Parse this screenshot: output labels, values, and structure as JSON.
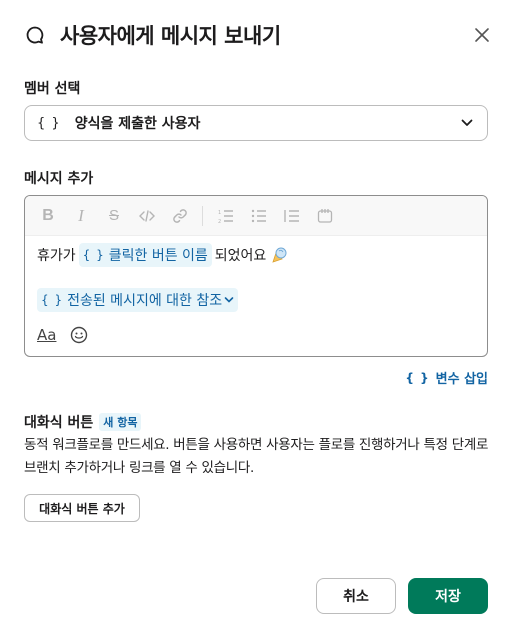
{
  "header": {
    "icon": "chat-bubble-icon",
    "title": "사용자에게 메시지 보내기",
    "close_icon": "close-icon"
  },
  "member_select": {
    "label": "멤버 선택",
    "var_icon": "{ }",
    "value": "양식을 제출한 사용자",
    "chevron": "chevron-down-icon"
  },
  "message": {
    "label": "메시지 추가",
    "toolbar": [
      "bold",
      "italic",
      "strikethrough",
      "code",
      "link",
      "numbered-list",
      "bulleted-list",
      "indent",
      "code-block"
    ],
    "line1_prefix": "휴가가",
    "line1_chip": "클릭한 버튼 이름",
    "line1_suffix": "되었어요",
    "line1_emoji": "party-emoji-icon",
    "line2_chip": "전송된 메시지에 대한 참조",
    "chip_brace": "{ }",
    "format_label": "Aa",
    "emoji_button": "smile-icon"
  },
  "insert_variable": {
    "brace": "{ }",
    "label": "변수 삽입"
  },
  "interactive_buttons": {
    "title": "대화식 버튼",
    "badge": "새 항목",
    "description": "동적 워크플로를 만드세요. 버튼을 사용하면 사용자는 플로를 진행하거나 특정 단계로 브랜치 추가하거나 링크를 열 수 있습니다.",
    "add_button": "대화식 버튼 추가"
  },
  "footer": {
    "cancel": "취소",
    "save": "저장"
  },
  "colors": {
    "accent": "#1264a3",
    "primary_button": "#007a5a",
    "chip_bg": "#e8f5fa"
  }
}
